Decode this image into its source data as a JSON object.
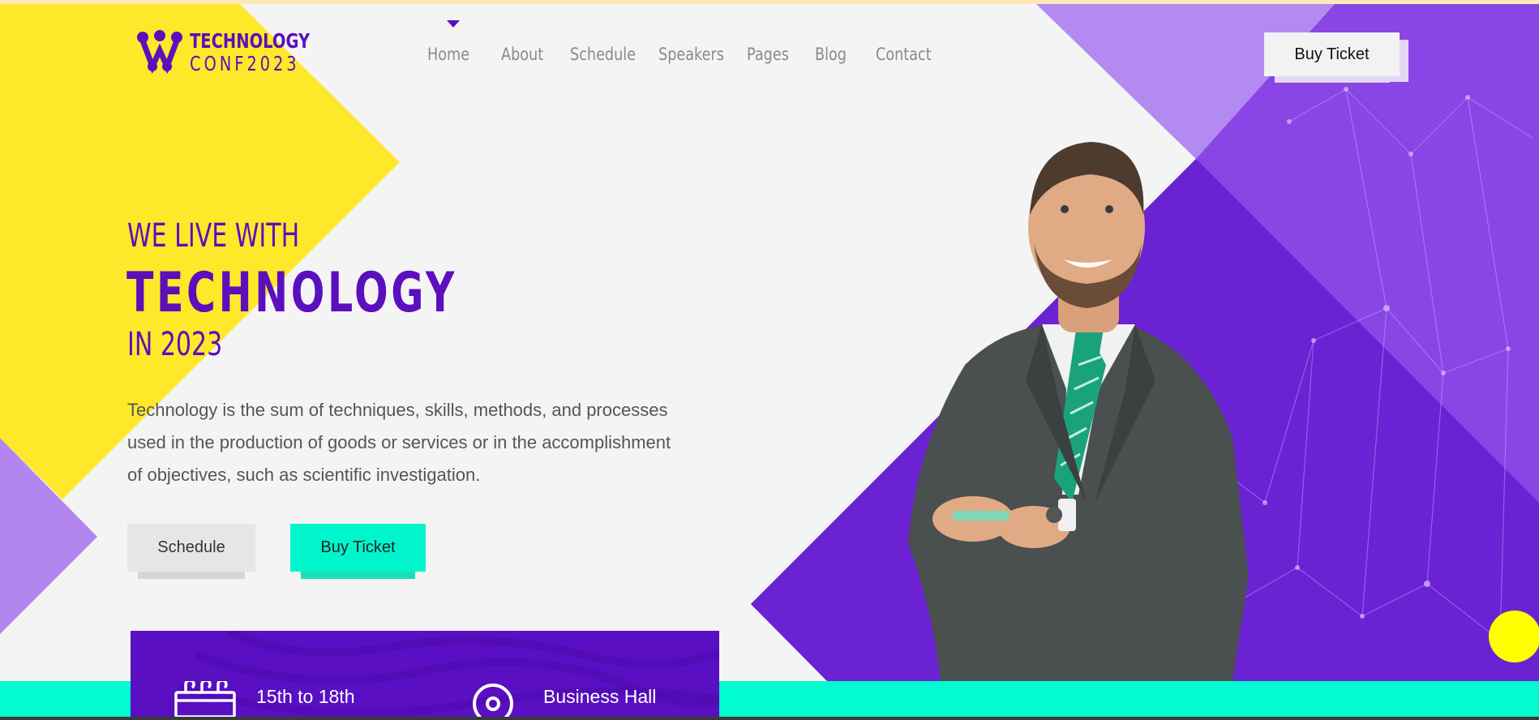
{
  "colors": {
    "brand_purple": "#5b0fbd",
    "accent_teal": "#00f5cc",
    "accent_yellow": "#ffe829",
    "lilac": "#b286ee"
  },
  "logo": {
    "line1": "TECHNOLOGY",
    "line2": "CONF2023",
    "icon": "molecule-logo-icon"
  },
  "nav": {
    "items": [
      {
        "label": "Home"
      },
      {
        "label": "About"
      },
      {
        "label": "Schedule"
      },
      {
        "label": "Speakers"
      },
      {
        "label": "Pages"
      },
      {
        "label": "Blog"
      },
      {
        "label": "Contact"
      }
    ],
    "active": "Home"
  },
  "header": {
    "buy_ticket_label": "Buy Ticket"
  },
  "hero": {
    "subtitle_top": "WE LIVE WITH",
    "title": "TECHNOLOGY",
    "subtitle_bottom": "IN 2023",
    "description": "Technology is the sum of techniques, skills, methods, and processes used in the production of goods or services or in the accomplishment of objectives, such as scientific investigation.",
    "schedule_button": "Schedule",
    "buy_button": "Buy Ticket"
  },
  "info": {
    "date": "15th to 18th",
    "venue": "Business Hall",
    "date_icon": "calendar-icon",
    "venue_icon": "location-pin-icon"
  }
}
